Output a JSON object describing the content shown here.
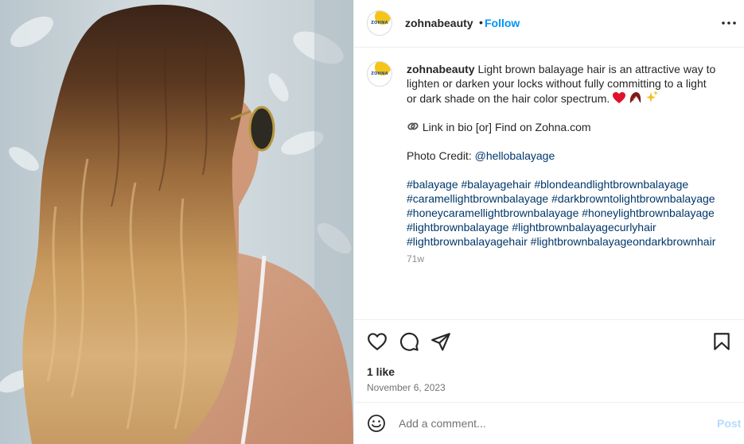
{
  "post": {
    "username": "zohnabeauty",
    "follow_label": "Follow",
    "separator": "•",
    "avatar_text": "ZOHNA",
    "caption": {
      "username": "zohnabeauty",
      "line1_text": " Light brown balayage hair is an attractive way to",
      "line2": "lighten or darken your locks without fully committing to a light",
      "line3": "or dark shade on the hair color spectrum.",
      "link_line": "Link in bio [or] Find on Zohna.com",
      "credit_prefix": "Photo Credit: ",
      "credit_handle": "@hellobalayage",
      "hashtag_lines": [
        "#balayage #balayagehair #blondeandlightbrownbalayage",
        "#caramellightbrownbalayage #darkbrowntolightbrownbalayage",
        "#honeycaramellightbrownbalayage #honeylightbrownbalayage",
        "#lightbrownbalayage #lightbrownbalayagecurlyhair",
        "#lightbrownbalayagehair #lightbrownbalayageondarkbrownhair"
      ]
    },
    "relative_time": "71w",
    "likes": "1 like",
    "date": "November 6, 2023",
    "comment_placeholder": "Add a comment...",
    "post_label": "Post"
  },
  "icons": [
    "more-icon",
    "heart-icon",
    "comment-icon",
    "share-icon",
    "bookmark-icon",
    "smiley-icon",
    "paperclip-icon",
    "heart-emoji",
    "sparkles-emoji"
  ],
  "colors": {
    "link_blue": "#0095f6",
    "hashtag": "#00376b",
    "muted": "#8e8e8e",
    "post_disabled": "#b3dbff",
    "brand_yellow": "#f5c418"
  }
}
